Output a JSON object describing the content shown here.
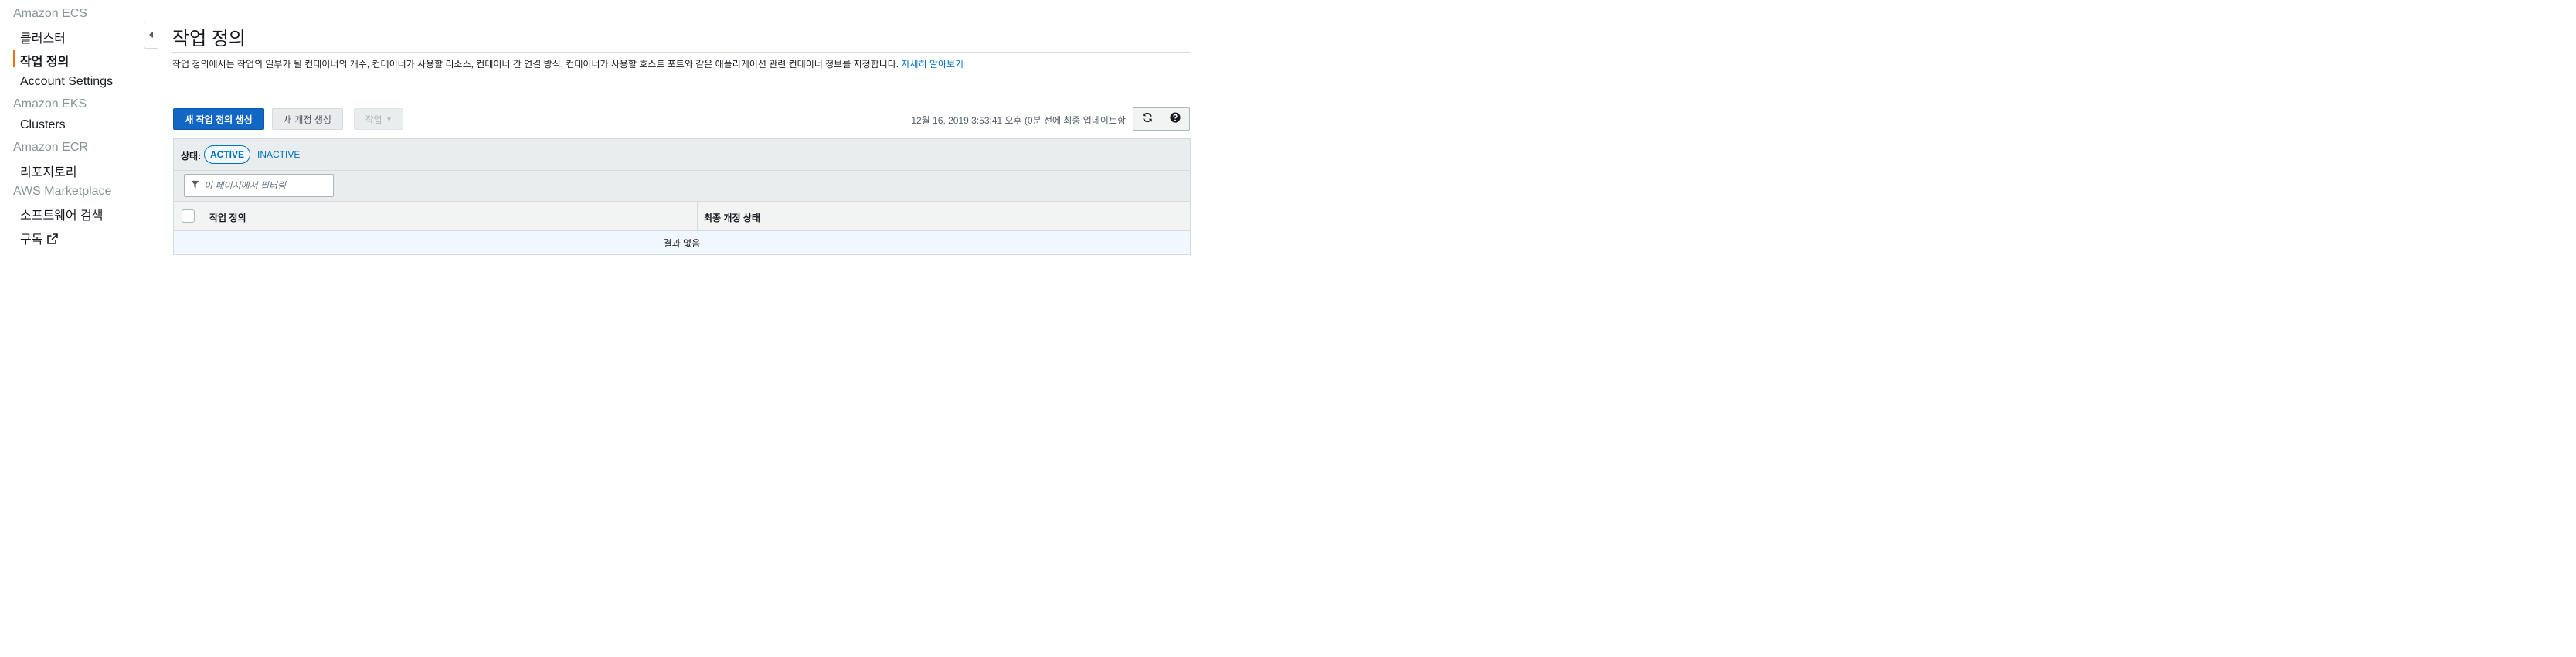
{
  "sidebar": {
    "sections": [
      {
        "title": "Amazon ECS",
        "items": [
          "클러스터",
          "작업 정의",
          "Account Settings"
        ]
      },
      {
        "title": "Amazon EKS",
        "items": [
          "Clusters"
        ]
      },
      {
        "title": "Amazon ECR",
        "items": [
          "리포지토리"
        ]
      },
      {
        "title": "AWS Marketplace",
        "items": [
          "소프트웨어 검색",
          "구독"
        ]
      }
    ],
    "active_item": "작업 정의"
  },
  "main": {
    "title": "작업 정의",
    "description": "작업 정의에서는 작업의 일부가 될 컨테이너의 개수, 컨테이너가 사용할 리소스, 컨테이너 간 연결 방식, 컨테이너가 사용할 호스트 포트와 같은 애플리케이션 관련 컨테이너 정보를 지정합니다.",
    "learn_more": "자세히 알아보기",
    "buttons": {
      "create": "새 작업 정의 생성",
      "new_revision": "새 개정 생성",
      "actions": "작업"
    },
    "timestamp": "12월 16, 2019 3:53:41 오후 (0분 전에 최종 업데이트함",
    "status_label": "상태:",
    "status_active": "ACTIVE",
    "status_inactive": "INACTIVE",
    "filter_placeholder": "이 페이지에서 필터링",
    "table": {
      "columns": [
        "작업 정의",
        "최종 개정 상태"
      ],
      "empty_text": "결과 없음"
    }
  },
  "icons": {
    "collapse": "caret-left-icon",
    "external": "external-link-icon",
    "refresh": "refresh-icon",
    "help": "help-icon",
    "filter": "filter-icon"
  },
  "colors": {
    "accent": "#ec7211",
    "primary": "#1266c4",
    "link": "#0073bb"
  }
}
